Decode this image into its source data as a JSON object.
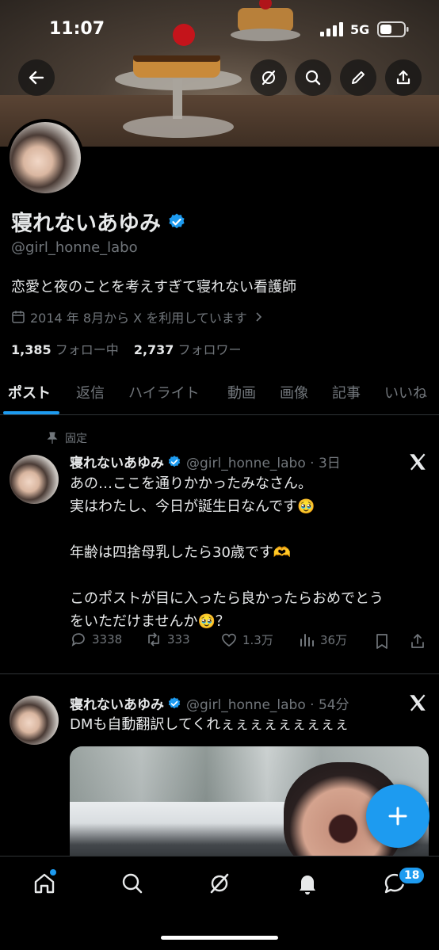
{
  "status_bar": {
    "time": "11:07",
    "network": "5G"
  },
  "header_actions": [
    "back-arrow-icon",
    "grok-icon",
    "search-icon",
    "edit-icon",
    "share-icon"
  ],
  "profile": {
    "name": "寝れないあゆみ",
    "handle": "@girl_honne_labo",
    "bio": "恋愛と夜のことを考えすぎて寝れない看護師",
    "joined": "2014 年 8月から X を利用しています",
    "following_count": "1,385",
    "following_label": "フォロー中",
    "followers_count": "2,737",
    "followers_label": "フォロワー"
  },
  "tabs": [
    {
      "label": "ポスト",
      "active": true
    },
    {
      "label": "返信"
    },
    {
      "label": "ハイライト"
    },
    {
      "label": "動画"
    },
    {
      "label": "画像"
    },
    {
      "label": "記事"
    },
    {
      "label": "いいね"
    }
  ],
  "posts": [
    {
      "pinned_label": "固定",
      "name": "寝れないあゆみ",
      "meta": "@girl_honne_labo · 3日",
      "text": "あの…ここを通りかかったみなさん。\n実はわたし、今日が誕生日なんです🥹\n\n年齢は四捨母乳したら30歳です🫶\n\nこのポストが目に入ったら良かったらおめでとう\nをいただけませんか🥹？",
      "replies": "3338",
      "reposts": "333",
      "likes": "1.3万",
      "views": "36万"
    },
    {
      "name": "寝れないあゆみ",
      "meta": "@girl_honne_labo · 54分",
      "text": "DMも自動翻訳してくれぇぇぇぇぇぇぇぇぇ"
    }
  ],
  "bottom_nav": {
    "items": [
      "home-icon",
      "search-icon",
      "grok-icon",
      "notifications-icon",
      "messages-icon"
    ],
    "messages_badge": "18"
  },
  "colors": {
    "accent": "#1d9bf0",
    "background": "#000000",
    "muted": "#71767b"
  }
}
